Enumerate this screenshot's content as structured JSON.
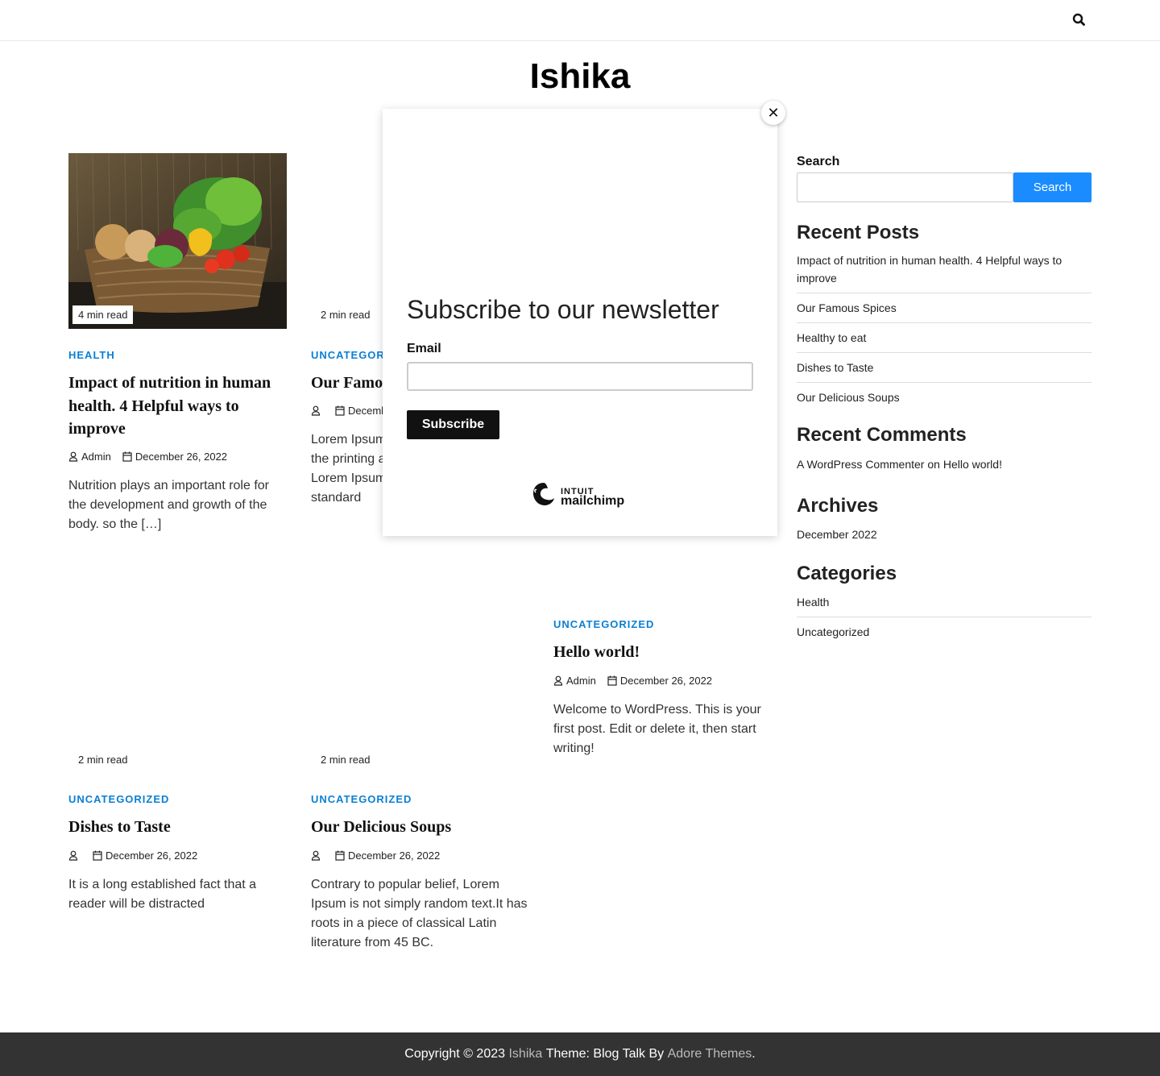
{
  "site": {
    "title": "Ishika",
    "search_icon": "search-icon"
  },
  "posts": [
    {
      "read_time": "4 min read",
      "category": "HEALTH",
      "title": "Impact of nutrition in human health. 4 Helpful ways to improve",
      "author": "Admin",
      "date": "December 26, 2022",
      "excerpt": "Nutrition plays an important role for the development and growth of the body. so the […]"
    },
    {
      "read_time": "2 min read",
      "category": "UNCATEGORI",
      "title": "Our Famou",
      "author": "",
      "date": "Decemb",
      "excerpt": "Lorem Ipsum the printing a Lorem Ipsum standard"
    },
    {
      "category": "UNCATEGORIZED",
      "title": "Hello world!",
      "author": "Admin",
      "date": "December 26, 2022",
      "excerpt": "Welcome to WordPress. This is your first post. Edit or delete it, then start writing!"
    },
    {
      "read_time": "2 min read",
      "category": "UNCATEGORIZED",
      "title": "Dishes to Taste",
      "author": "",
      "date": "December 26, 2022",
      "excerpt": "It is a long established fact that a reader will be distracted"
    },
    {
      "read_time": "2 min read",
      "category": "UNCATEGORIZED",
      "title": "Our Delicious Soups",
      "author": "",
      "date": "December 26, 2022",
      "excerpt": "Contrary to popular belief, Lorem Ipsum is not simply random text.It has roots in a piece of classical Latin literature from 45 BC."
    }
  ],
  "sidebar": {
    "search_label": "Search",
    "search_button": "Search",
    "recent_posts_heading": "Recent Posts",
    "recent_posts": [
      "Impact of nutrition in human health. 4 Helpful ways to improve",
      "Our Famous Spices",
      "Healthy to eat",
      "Dishes to Taste",
      "Our Delicious Soups"
    ],
    "recent_comments_heading": "Recent Comments",
    "comment_author": "A WordPress Commenter",
    "comment_on": "on",
    "comment_post": "Hello world!",
    "archives_heading": "Archives",
    "archives": [
      "December 2022"
    ],
    "categories_heading": "Categories",
    "categories": [
      "Health",
      "Uncategorized"
    ]
  },
  "popup": {
    "title": "Subscribe to our newsletter",
    "email_label": "Email",
    "email_value": "",
    "subscribe_button": "Subscribe",
    "close_symbol": "✕",
    "brand_line1": "INTUIT",
    "brand_line2": "mailchimp"
  },
  "footer": {
    "copyright": "Copyright © 2023",
    "site_link": "Ishika",
    "theme_text": "Theme: Blog Talk By",
    "author_link": "Adore Themes",
    "period": "."
  },
  "colors": {
    "accent": "#0b7fd4",
    "button": "#1a8cff",
    "footer_bg": "#333333"
  }
}
